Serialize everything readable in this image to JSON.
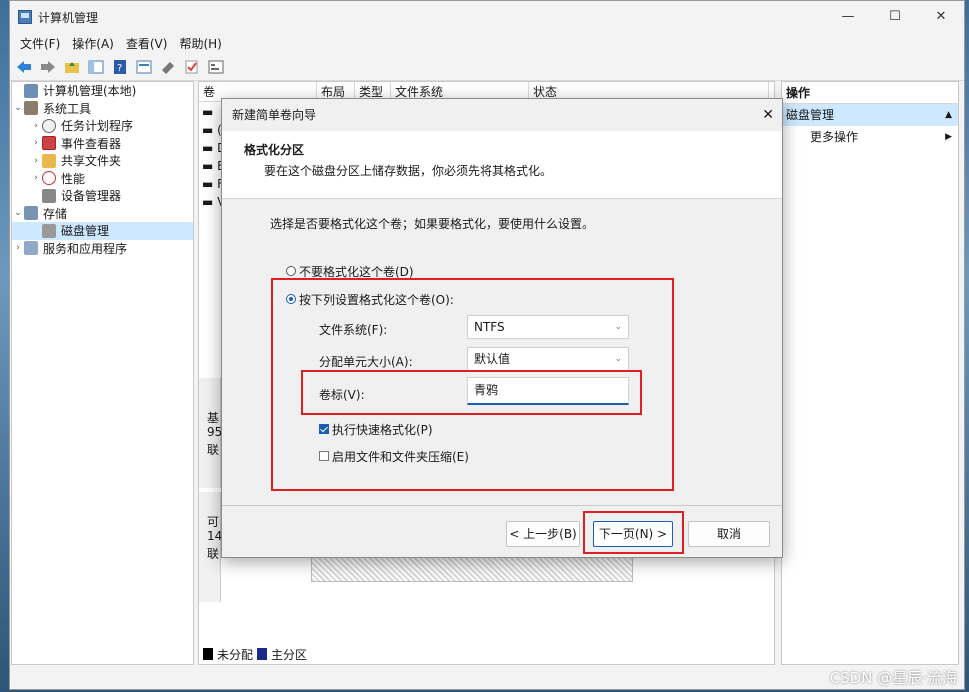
{
  "window": {
    "title": "计算机管理"
  },
  "menu": [
    "文件(F)",
    "操作(A)",
    "查看(V)",
    "帮助(H)"
  ],
  "tree": {
    "root": "计算机管理(本地)",
    "system_tools": "系统工具",
    "task_scheduler": "任务计划程序",
    "event_viewer": "事件查看器",
    "shared_folders": "共享文件夹",
    "performance": "性能",
    "device_manager": "设备管理器",
    "storage": "存储",
    "disk_management": "磁盘管理",
    "services": "服务和应用程序"
  },
  "columns": [
    "卷",
    "布局",
    "类型",
    "文件系统",
    "状态"
  ],
  "volume_rows": [
    "▬",
    "▬ (",
    "▬ D",
    "▬ E",
    "▬ F",
    "▬ V"
  ],
  "disk_fragments": {
    "d0a": "基",
    "d0b": "95",
    "d0c": "联",
    "d1a": "可",
    "d1b": "14",
    "d1c": "联"
  },
  "legend": {
    "unallocated": "未分配",
    "primary": "主分区"
  },
  "actions": {
    "header": "操作",
    "selected": "磁盘管理",
    "more": "更多操作"
  },
  "dialog": {
    "title": "新建简单卷向导",
    "heading": "格式化分区",
    "subheading": "要在这个磁盘分区上储存数据，你必须先将其格式化。",
    "question": "选择是否要格式化这个卷；如果要格式化，要使用什么设置。",
    "opt_no_format": "不要格式化这个卷(D)",
    "opt_format": "按下列设置格式化这个卷(O):",
    "fs_label": "文件系统(F):",
    "fs_value": "NTFS",
    "alloc_label": "分配单元大小(A):",
    "alloc_value": "默认值",
    "vol_label": "卷标(V):",
    "vol_value": "青鸦",
    "quick_format": "执行快速格式化(P)",
    "compress": "启用文件和文件夹压缩(E)",
    "back": "< 上一步(B)",
    "next": "下一页(N) >",
    "cancel": "取消"
  },
  "watermark": "CSDN @星辰·流海",
  "colors": {
    "accent": "#1a5fb4",
    "highlight_box": "#e02020",
    "selection": "#cde8ff"
  }
}
